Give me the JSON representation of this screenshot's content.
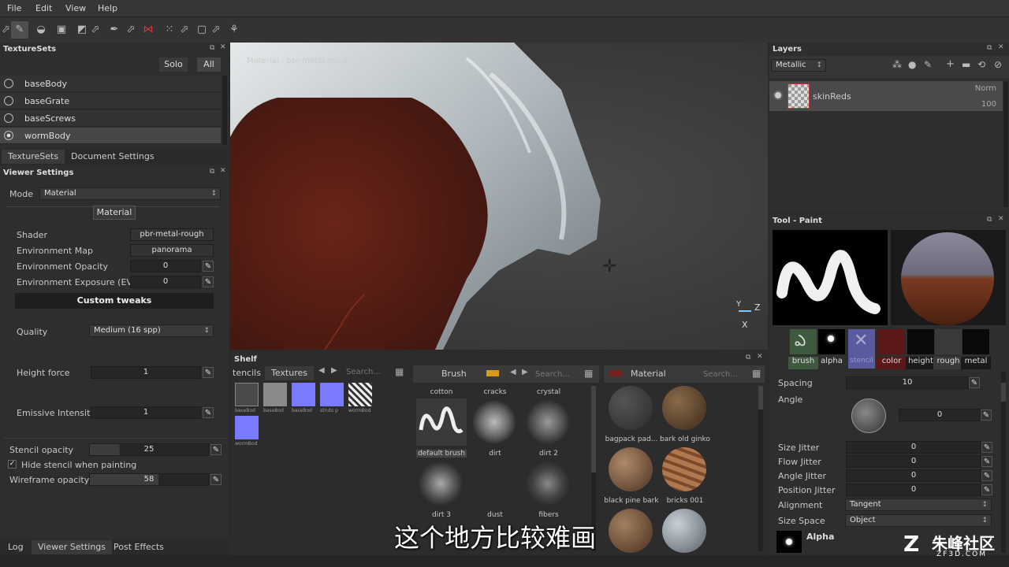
{
  "menu": {
    "file": "File",
    "edit": "Edit",
    "view": "View",
    "help": "Help"
  },
  "texturesets": {
    "title": "TextureSets",
    "solo": "Solo",
    "all": "All",
    "items": [
      "baseBody",
      "baseGrate",
      "baseScrews",
      "wormBody"
    ],
    "tabs": [
      "TextureSets",
      "Document Settings"
    ]
  },
  "viewer": {
    "title": "Viewer Settings",
    "mode_label": "Mode",
    "mode_value": "Material",
    "section": "Material",
    "shader_label": "Shader",
    "shader_value": "pbr-metal-rough",
    "envmap_label": "Environment Map",
    "envmap_value": "panorama",
    "envop_label": "Environment Opacity",
    "envop_value": "0",
    "envexp_label": "Environment Exposure (EV)",
    "envexp_value": "0",
    "custom": "Custom tweaks",
    "quality_label": "Quality",
    "quality_value": "Medium (16 spp)",
    "height_label": "Height force",
    "height_value": "1",
    "emissive_label": "Emissive Intensity",
    "emissive_value": "1",
    "stencil_label": "Stencil opacity",
    "stencil_value": "25",
    "hide_stencil": "Hide stencil when painting",
    "wire_label": "Wireframe opacity",
    "wire_value": "58"
  },
  "bottom_tabs": [
    "Log",
    "Viewer Settings",
    "Post Effects"
  ],
  "viewport": {
    "label": "Material - pbr-metal-rough",
    "axis_y": "Y",
    "axis_z": "Z",
    "axis_x": "X"
  },
  "shelf": {
    "title": "Shelf",
    "tab1": "tencils",
    "tab2": "Textures",
    "search": "Search...",
    "tex_labels": [
      "baseBod",
      "baseBod",
      "baseBod",
      "struts p",
      "wormBod",
      "wormBod"
    ],
    "brush_tab": "Brush",
    "brush_search": "Search...",
    "brushes": [
      "cotton",
      "cracks",
      "crystal",
      "default brush",
      "dirt",
      "dirt 2",
      "dirt 3",
      "dust",
      "fibers"
    ],
    "material_tab": "Material",
    "material_search": "Search...",
    "materials": [
      "bagpack pad...",
      "bark old ginko",
      "black pine bark",
      "bricks 001"
    ]
  },
  "layers": {
    "title": "Layers",
    "channel": "Metallic",
    "layer_name": "skinReds",
    "blend": "Norm",
    "opacity": "100"
  },
  "tool": {
    "title": "Tool - Paint",
    "channels": [
      "brush",
      "alpha",
      "stencil",
      "color",
      "height",
      "rough",
      "metal"
    ],
    "spacing_label": "Spacing",
    "spacing_value": "10",
    "angle_label": "Angle",
    "angle_value": "0",
    "size_jitter_label": "Size Jitter",
    "size_jitter": "0",
    "flow_jitter_label": "Flow Jitter",
    "flow_jitter": "0",
    "angle_jitter_label": "Angle Jitter",
    "angle_jitter": "0",
    "pos_jitter_label": "Position Jitter",
    "pos_jitter": "0",
    "alignment_label": "Alignment",
    "alignment_value": "Tangent",
    "sizespace_label": "Size Space",
    "sizespace_value": "Object",
    "alpha_label": "Alpha"
  },
  "subtitle": "这个地方比较难画",
  "watermark": {
    "main": "朱峰社区",
    "sub": "ZF3D.COM"
  }
}
